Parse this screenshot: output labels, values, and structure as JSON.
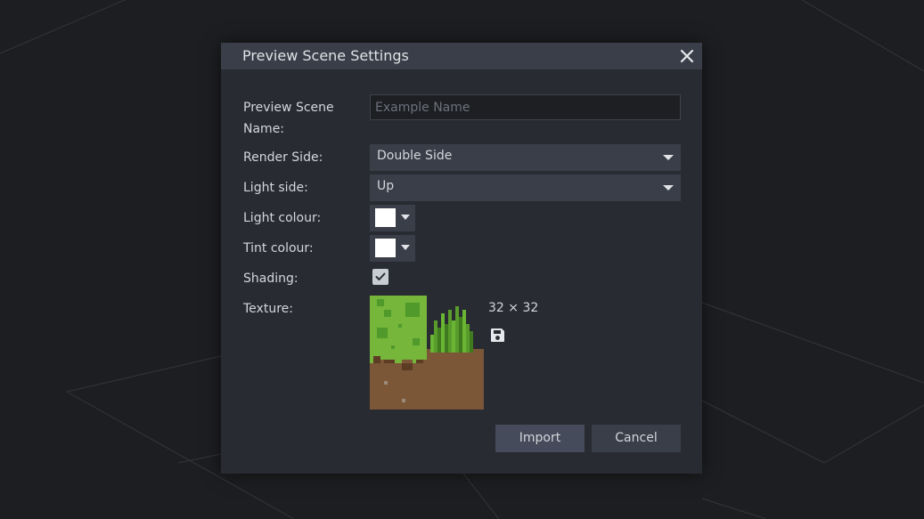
{
  "dialog": {
    "title": "Preview Scene Settings",
    "close_icon": "close-icon"
  },
  "form": {
    "name_label": "Preview Scene Name:",
    "name_placeholder": "Example Name",
    "name_value": "",
    "render_side_label": "Render Side:",
    "render_side_value": "Double Side",
    "light_side_label": "Light side:",
    "light_side_value": "Up",
    "light_colour_label": "Light colour:",
    "light_colour_value": "#ffffff",
    "tint_colour_label": "Tint colour:",
    "tint_colour_value": "#ffffff",
    "shading_label": "Shading:",
    "shading_checked": true,
    "texture_label": "Texture:",
    "texture_size": "32 ⨯ 32",
    "texture_save_icon": "save-icon"
  },
  "buttons": {
    "import_label": "Import",
    "cancel_label": "Cancel"
  },
  "colors": {
    "accent_button": "#454b5a",
    "panel": "#282b31",
    "header": "#3a3e48"
  }
}
